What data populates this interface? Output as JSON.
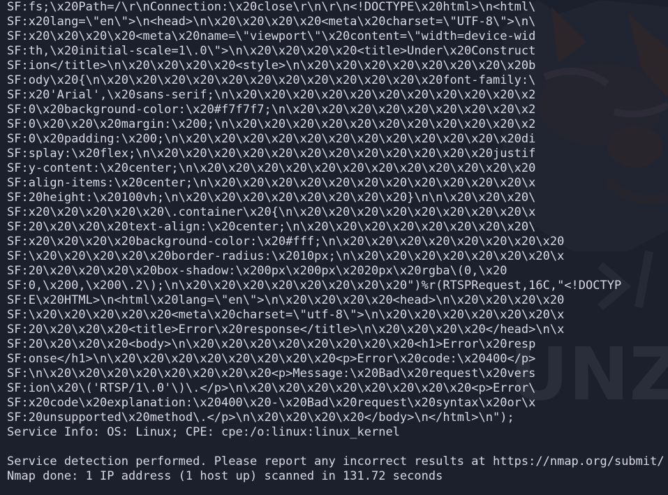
{
  "terminal": {
    "lines": [
      "SF:fs;\\x20Path=/\\r\\nConnection:\\x20close\\r\\n\\r\\n<!DOCTYPE\\x20html>\\n<html\\",
      "SF:x20lang=\\\"en\\\">\\n<head>\\n\\x20\\x20\\x20\\x20<meta\\x20charset=\\\"UTF-8\\\">\\n\\",
      "SF:x20\\x20\\x20\\x20<meta\\x20name=\\\"viewport\\\"\\x20content=\\\"width=device-wid",
      "SF:th,\\x20initial-scale=1\\.0\\\">\\n\\x20\\x20\\x20\\x20<title>Under\\x20Construct",
      "SF:ion</title>\\n\\x20\\x20\\x20\\x20<style>\\n\\x20\\x20\\x20\\x20\\x20\\x20\\x20\\x20b",
      "SF:ody\\x20{\\n\\x20\\x20\\x20\\x20\\x20\\x20\\x20\\x20\\x20\\x20\\x20\\x20font-family:\\",
      "SF:x20'Arial',\\x20sans-serif;\\n\\x20\\x20\\x20\\x20\\x20\\x20\\x20\\x20\\x20\\x20\\x2",
      "SF:0\\x20background-color:\\x20#f7f7f7;\\n\\x20\\x20\\x20\\x20\\x20\\x20\\x20\\x20\\x2",
      "SF:0\\x20\\x20\\x20margin:\\x200;\\n\\x20\\x20\\x20\\x20\\x20\\x20\\x20\\x20\\x20\\x20\\x2",
      "SF:0\\x20padding:\\x200;\\n\\x20\\x20\\x20\\x20\\x20\\x20\\x20\\x20\\x20\\x20\\x20\\x20di",
      "SF:splay:\\x20flex;\\n\\x20\\x20\\x20\\x20\\x20\\x20\\x20\\x20\\x20\\x20\\x20\\x20justif",
      "SF:y-content:\\x20center;\\n\\x20\\x20\\x20\\x20\\x20\\x20\\x20\\x20\\x20\\x20\\x20\\x20",
      "SF:align-items:\\x20center;\\n\\x20\\x20\\x20\\x20\\x20\\x20\\x20\\x20\\x20\\x20\\x20\\x",
      "SF:20height:\\x20100vh;\\n\\x20\\x20\\x20\\x20\\x20\\x20\\x20\\x20}\\n\\n\\x20\\x20\\x20\\",
      "SF:x20\\x20\\x20\\x20\\x20\\.container\\x20{\\n\\x20\\x20\\x20\\x20\\x20\\x20\\x20\\x20\\x",
      "SF:20\\x20\\x20\\x20text-align:\\x20center;\\n\\x20\\x20\\x20\\x20\\x20\\x20\\x20\\x20\\",
      "SF:x20\\x20\\x20\\x20background-color:\\x20#fff;\\n\\x20\\x20\\x20\\x20\\x20\\x20\\x20\\x20",
      "SF:\\x20\\x20\\x20\\x20\\x20border-radius:\\x2010px;\\n\\x20\\x20\\x20\\x20\\x20\\x20\\x20\\x",
      "SF:20\\x20\\x20\\x20\\x20box-shadow:\\x200px\\x200px\\x2020px\\x20rgba\\(0,\\x20",
      "SF:0,\\x200,\\x200\\.2\\);\\n\\x20\\x20\\x20\\x20\\x20\\x20\\x20\\x20\")%r(RTSPRequest,16C,\"<!DOCTYP",
      "SF:E\\x20HTML>\\n<html\\x20lang=\\\"en\\\">\\n\\x20\\x20\\x20\\x20<head>\\n\\x20\\x20\\x20\\x20",
      "SF:\\x20\\x20\\x20\\x20\\x20<meta\\x20charset=\\\"utf-8\\\">\\n\\x20\\x20\\x20\\x20\\x20\\x20\\x",
      "SF:20\\x20\\x20\\x20<title>Error\\x20response</title>\\n\\x20\\x20\\x20\\x20</head>\\n\\x",
      "SF:20\\x20\\x20\\x20<body>\\n\\x20\\x20\\x20\\x20\\x20\\x20\\x20\\x20<h1>Error\\x20resp",
      "SF:onse</h1>\\n\\x20\\x20\\x20\\x20\\x20\\x20\\x20\\x20<p>Error\\x20code:\\x20400</p>",
      "SF:\\n\\x20\\x20\\x20\\x20\\x20\\x20\\x20\\x20<p>Message:\\x20Bad\\x20request\\x20vers",
      "SF:ion\\x20\\('RTSP/1\\.0'\\)\\.</p>\\n\\x20\\x20\\x20\\x20\\x20\\x20\\x20\\x20<p>Error\\",
      "SF:x20code\\x20explanation:\\x20400\\x20-\\x20Bad\\x20request\\x20syntax\\x20or\\x",
      "SF:20unsupported\\x20method\\.</p>\\n\\x20\\x20\\x20\\x20</body>\\n</html>\\n\");",
      "Service Info: OS: Linux; CPE: cpe:/o:linux:linux_kernel",
      "",
      "Service detection performed. Please report any incorrect results at https://nmap.org/submit/ .",
      "Nmap done: 1 IP address (1 host up) scanned in 131.72 seconds"
    ]
  },
  "colors": {
    "background": "#1c1f2c",
    "text": "#d7d9e4",
    "watermark": "#2a2d3a"
  },
  "wallpaper": {
    "watermark_text": "UNZ"
  }
}
